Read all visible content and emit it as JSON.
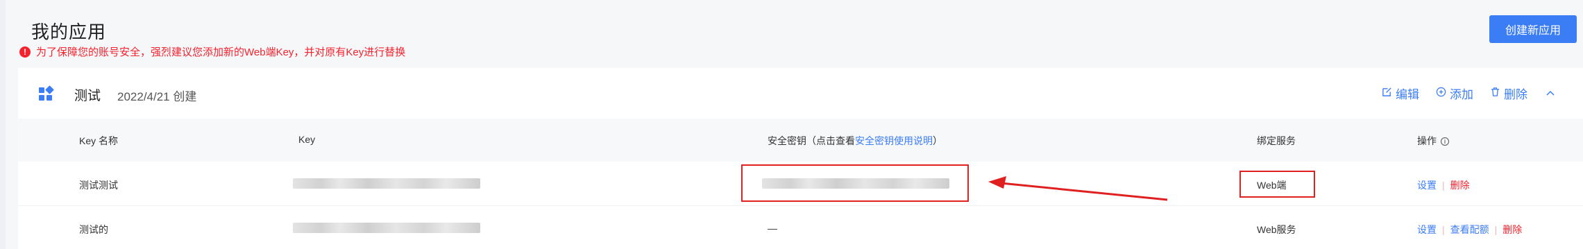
{
  "page": {
    "title": "我的应用",
    "warning": "为了保障您的账号安全，强烈建议您添加新的Web端Key，并对原有Key进行替换",
    "create_button": "创建新应用"
  },
  "app": {
    "name": "测试",
    "created": "2022/4/21 创建",
    "actions": {
      "edit": "编辑",
      "add": "添加",
      "delete": "删除"
    }
  },
  "table": {
    "headers": {
      "key_name": "Key 名称",
      "key": "Key",
      "secret_prefix": "安全密钥（点击查看",
      "secret_link": "安全密钥使用说明",
      "secret_suffix": "）",
      "service": "绑定服务",
      "ops": "操作"
    },
    "rows": [
      {
        "name": "测试测试",
        "secret": "",
        "service": "Web端",
        "ops": [
          "设置",
          "删除"
        ]
      },
      {
        "name": "测试的",
        "secret": "—",
        "service": "Web服务",
        "ops": [
          "设置",
          "查看配额",
          "删除"
        ]
      }
    ]
  },
  "colors": {
    "accent": "#3b7df5",
    "danger": "#f5222d",
    "annotation": "#e02020"
  },
  "icons": [
    "warning-icon",
    "app-grid-icon",
    "edit-icon",
    "plus-circle-icon",
    "trash-icon",
    "chevron-up-icon",
    "info-icon"
  ]
}
